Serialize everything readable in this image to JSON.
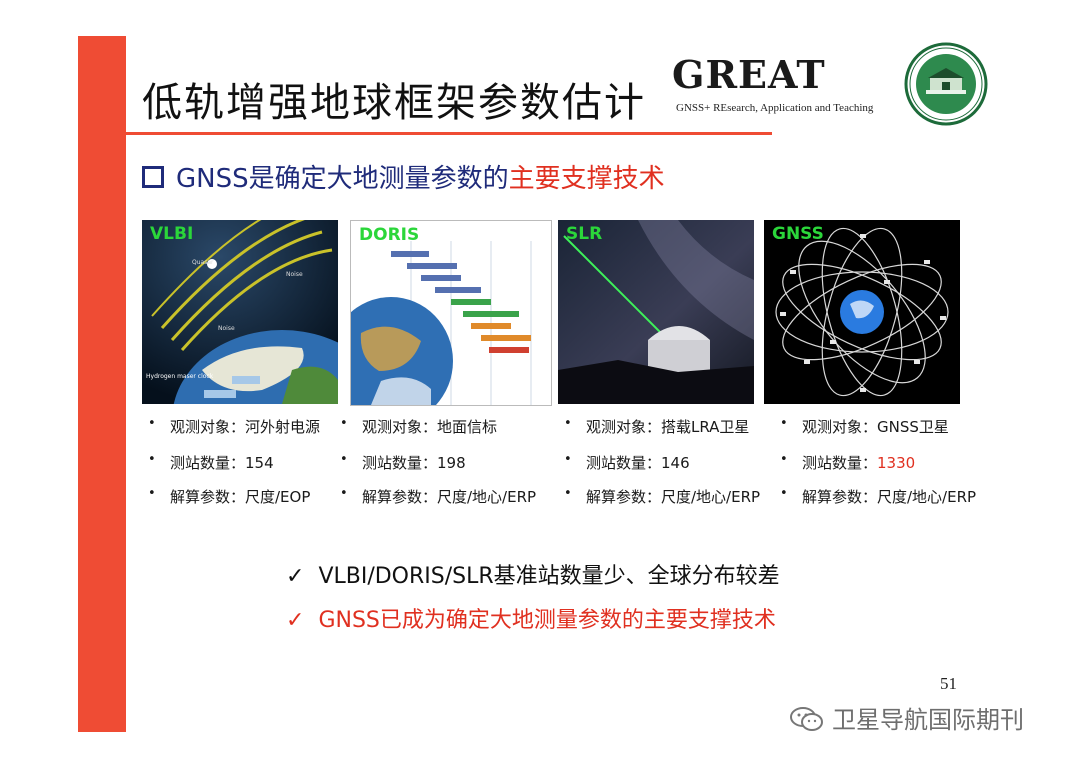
{
  "slide": {
    "title": "低轨增强地球框架参数估计",
    "logo": {
      "name": "GREAT",
      "subtitle": "GNSS+ REsearch, Application and Teaching"
    },
    "subhead": {
      "prefix": "GNSS是确定大地测量参数的",
      "highlight": "主要支撑技术"
    },
    "panels": [
      {
        "label": "VLBI",
        "items": [
          "观测对象：河外射电源",
          "测站数量：154",
          "解算参数：尺度/EOP"
        ]
      },
      {
        "label": "DORIS",
        "items": [
          "观测对象：地面信标",
          "测站数量：198",
          "解算参数：尺度/地心/ERP"
        ]
      },
      {
        "label": "SLR",
        "items": [
          "观测对象：搭载LRA卫星",
          "测站数量：146",
          "解算参数：尺度/地心/ERP"
        ]
      },
      {
        "label": "GNSS",
        "items": [
          "观测对象：GNSS卫星",
          "测站数量：",
          "解算参数：尺度/地心/ERP"
        ],
        "count_highlight": "1330"
      }
    ],
    "bullet_glyph": "•",
    "conclusions": [
      {
        "mark": "✓",
        "text": "VLBI/DORIS/SLR基准站数量少、全球分布较差"
      },
      {
        "mark": "✓",
        "text": "GNSS已成为确定大地测量参数的主要支撑技术"
      }
    ],
    "page_number": "51",
    "watermark": "卫星导航国际期刊"
  },
  "colors": {
    "accent": "#ef4c34",
    "navy": "#1f2b7a",
    "highlight": "#e03020",
    "panel_label": "#2bd63a"
  }
}
